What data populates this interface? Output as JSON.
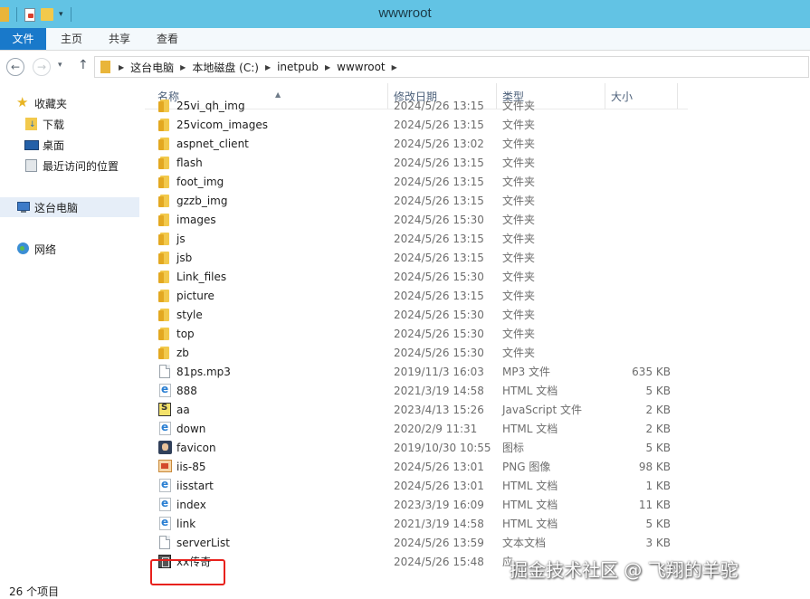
{
  "window": {
    "title": "wwwroot"
  },
  "ribbon": {
    "tabs": [
      "文件",
      "主页",
      "共享",
      "查看"
    ]
  },
  "address": {
    "crumbs": [
      "这台电脑",
      "本地磁盘 (C:)",
      "inetpub",
      "wwwroot"
    ]
  },
  "nav": {
    "favorites_label": "收藏夹",
    "favorites": [
      "下载",
      "桌面",
      "最近访问的位置"
    ],
    "this_pc": "这台电脑",
    "network": "网络"
  },
  "columns": {
    "name": "名称",
    "date": "修改日期",
    "type": "类型",
    "size": "大小"
  },
  "files": [
    {
      "name": "25vi_qh_img",
      "date": "2024/5/26 13:15",
      "type": "文件夹",
      "size": "",
      "icon": "folder"
    },
    {
      "name": "25vicom_images",
      "date": "2024/5/26 13:15",
      "type": "文件夹",
      "size": "",
      "icon": "folder"
    },
    {
      "name": "aspnet_client",
      "date": "2024/5/26 13:02",
      "type": "文件夹",
      "size": "",
      "icon": "folder"
    },
    {
      "name": "flash",
      "date": "2024/5/26 13:15",
      "type": "文件夹",
      "size": "",
      "icon": "folder"
    },
    {
      "name": "foot_img",
      "date": "2024/5/26 13:15",
      "type": "文件夹",
      "size": "",
      "icon": "folder"
    },
    {
      "name": "gzzb_img",
      "date": "2024/5/26 13:15",
      "type": "文件夹",
      "size": "",
      "icon": "folder"
    },
    {
      "name": "images",
      "date": "2024/5/26 15:30",
      "type": "文件夹",
      "size": "",
      "icon": "folder"
    },
    {
      "name": "js",
      "date": "2024/5/26 13:15",
      "type": "文件夹",
      "size": "",
      "icon": "folder"
    },
    {
      "name": "jsb",
      "date": "2024/5/26 13:15",
      "type": "文件夹",
      "size": "",
      "icon": "folder"
    },
    {
      "name": "Link_files",
      "date": "2024/5/26 15:30",
      "type": "文件夹",
      "size": "",
      "icon": "folder"
    },
    {
      "name": "picture",
      "date": "2024/5/26 13:15",
      "type": "文件夹",
      "size": "",
      "icon": "folder"
    },
    {
      "name": "style",
      "date": "2024/5/26 15:30",
      "type": "文件夹",
      "size": "",
      "icon": "folder"
    },
    {
      "name": "top",
      "date": "2024/5/26 15:30",
      "type": "文件夹",
      "size": "",
      "icon": "folder"
    },
    {
      "name": "zb",
      "date": "2024/5/26 15:30",
      "type": "文件夹",
      "size": "",
      "icon": "folder"
    },
    {
      "name": "81ps.mp3",
      "date": "2019/11/3 16:03",
      "type": "MP3 文件",
      "size": "635 KB",
      "icon": "document"
    },
    {
      "name": "888",
      "date": "2021/3/19 14:58",
      "type": "HTML 文档",
      "size": "5 KB",
      "icon": "html"
    },
    {
      "name": "aa",
      "date": "2023/4/13 15:26",
      "type": "JavaScript 文件",
      "size": "2 KB",
      "icon": "javascript"
    },
    {
      "name": "down",
      "date": "2020/2/9 11:31",
      "type": "HTML 文档",
      "size": "2 KB",
      "icon": "html"
    },
    {
      "name": "favicon",
      "date": "2019/10/30 10:55",
      "type": "图标",
      "size": "5 KB",
      "icon": "favicon"
    },
    {
      "name": "iis-85",
      "date": "2024/5/26 13:01",
      "type": "PNG 图像",
      "size": "98 KB",
      "icon": "png"
    },
    {
      "name": "iisstart",
      "date": "2024/5/26 13:01",
      "type": "HTML 文档",
      "size": "1 KB",
      "icon": "html"
    },
    {
      "name": "index",
      "date": "2023/3/19 16:09",
      "type": "HTML 文档",
      "size": "11 KB",
      "icon": "html"
    },
    {
      "name": "link",
      "date": "2021/3/19 14:58",
      "type": "HTML 文档",
      "size": "5 KB",
      "icon": "html"
    },
    {
      "name": "serverList",
      "date": "2024/5/26 13:59",
      "type": "文本文档",
      "size": "3 KB",
      "icon": "document"
    },
    {
      "name": "xx传奇",
      "date": "2024/5/26 15:48",
      "type": "应",
      "size": "",
      "icon": "executable"
    }
  ],
  "status": {
    "count_text": "26 个项目"
  },
  "watermark": "掘金技术社区 @ 飞翔的羊驼",
  "colors": {
    "titlebar": "#62c3e4",
    "file_tab": "#1979ca",
    "highlight": "#e8211c"
  }
}
